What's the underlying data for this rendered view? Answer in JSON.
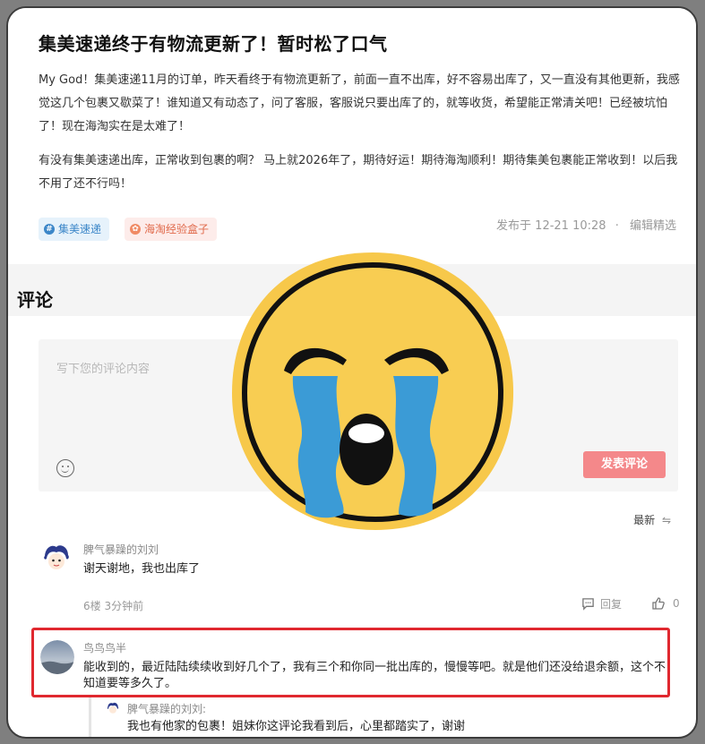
{
  "post": {
    "title": "集美速递终于有物流更新了！暂时松了口气",
    "paragraph1": "My God！集美速递11月的订单，昨天看终于有物流更新了，前面一直不出库，好不容易出库了，又一直没有其他更新，我感觉这几个包裹又歇菜了！谁知道又有动态了，问了客服，客服说只要出库了的，就等收货，希望能正常清关吧！已经被坑怕了！现在海淘实在是太难了！",
    "paragraph2": "有没有集美速递出库，正常收到包裹的啊？ 马上就2026年了，期待好运！期待海淘顺利！期待集美包裹能正常收到！以后我不用了还不行吗！",
    "tags": [
      {
        "label": "集美速递",
        "icon": "hash-icon",
        "color": "#3b86c8"
      },
      {
        "label": "海淘经验盒子",
        "icon": "box-icon",
        "color": "#e0694a"
      }
    ],
    "published": "发布于 12-21 10:28",
    "separator": "·",
    "editor_pick": "编辑精选"
  },
  "comments_section": {
    "title": "评论",
    "placeholder": "写下您的评论内容",
    "submit_label": "发表评论",
    "sort_label": "最新",
    "sort_icon": "swap-icon"
  },
  "comments": [
    {
      "user": "脾气暴躁的刘刘",
      "text": "谢天谢地，我也出库了",
      "floor_time": "6楼 3分钟前",
      "reply_label": "回复",
      "likes": "0"
    },
    {
      "user": "鸟鸟鸟半",
      "text": "能收到的，最近陆陆续续收到好几个了，我有三个和你同一批出库的，慢慢等吧。就是他们还没给退余额，这个不知道要等多久了。",
      "highlight_color": "#e0282f"
    }
  ],
  "reply": {
    "user": "脾气暴躁的刘刘:",
    "text": "我也有他家的包裹！姐妹你这评论我看到后，心里都踏实了，谢谢"
  },
  "overlay": {
    "icon": "loudly-crying-face-icon",
    "colors": {
      "face": "#f8c94c",
      "tears": "#3b9bd6",
      "outline": "#111111"
    }
  }
}
